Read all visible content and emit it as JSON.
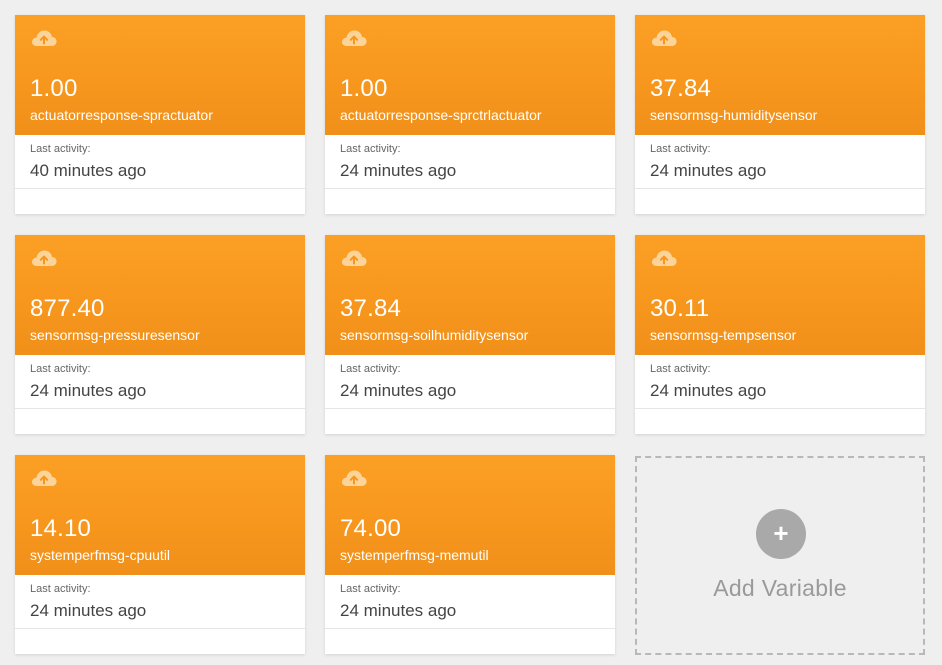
{
  "colors": {
    "card_top": "#f7961d",
    "background": "#efefef",
    "add_circle": "#a9a9a9"
  },
  "variables": [
    {
      "value": "1.00",
      "name": "actuatorresponse-spractuator",
      "activity_label": "Last activity:",
      "activity": "40 minutes ago",
      "icon": "cloud-upload-icon"
    },
    {
      "value": "1.00",
      "name": "actuatorresponse-sprctrlactuator",
      "activity_label": "Last activity:",
      "activity": "24 minutes ago",
      "icon": "cloud-upload-icon"
    },
    {
      "value": "37.84",
      "name": "sensormsg-humiditysensor",
      "activity_label": "Last activity:",
      "activity": "24 minutes ago",
      "icon": "cloud-upload-icon"
    },
    {
      "value": "877.40",
      "name": "sensormsg-pressuresensor",
      "activity_label": "Last activity:",
      "activity": "24 minutes ago",
      "icon": "cloud-upload-icon"
    },
    {
      "value": "37.84",
      "name": "sensormsg-soilhumiditysensor",
      "activity_label": "Last activity:",
      "activity": "24 minutes ago",
      "icon": "cloud-upload-icon"
    },
    {
      "value": "30.11",
      "name": "sensormsg-tempsensor",
      "activity_label": "Last activity:",
      "activity": "24 minutes ago",
      "icon": "cloud-upload-icon"
    },
    {
      "value": "14.10",
      "name": "systemperfmsg-cpuutil",
      "activity_label": "Last activity:",
      "activity": "24 minutes ago",
      "icon": "cloud-upload-icon"
    },
    {
      "value": "74.00",
      "name": "systemperfmsg-memutil",
      "activity_label": "Last activity:",
      "activity": "24 minutes ago",
      "icon": "cloud-upload-icon"
    }
  ],
  "add_variable": {
    "label": "Add Variable",
    "symbol": "+",
    "icon": "plus-icon"
  }
}
